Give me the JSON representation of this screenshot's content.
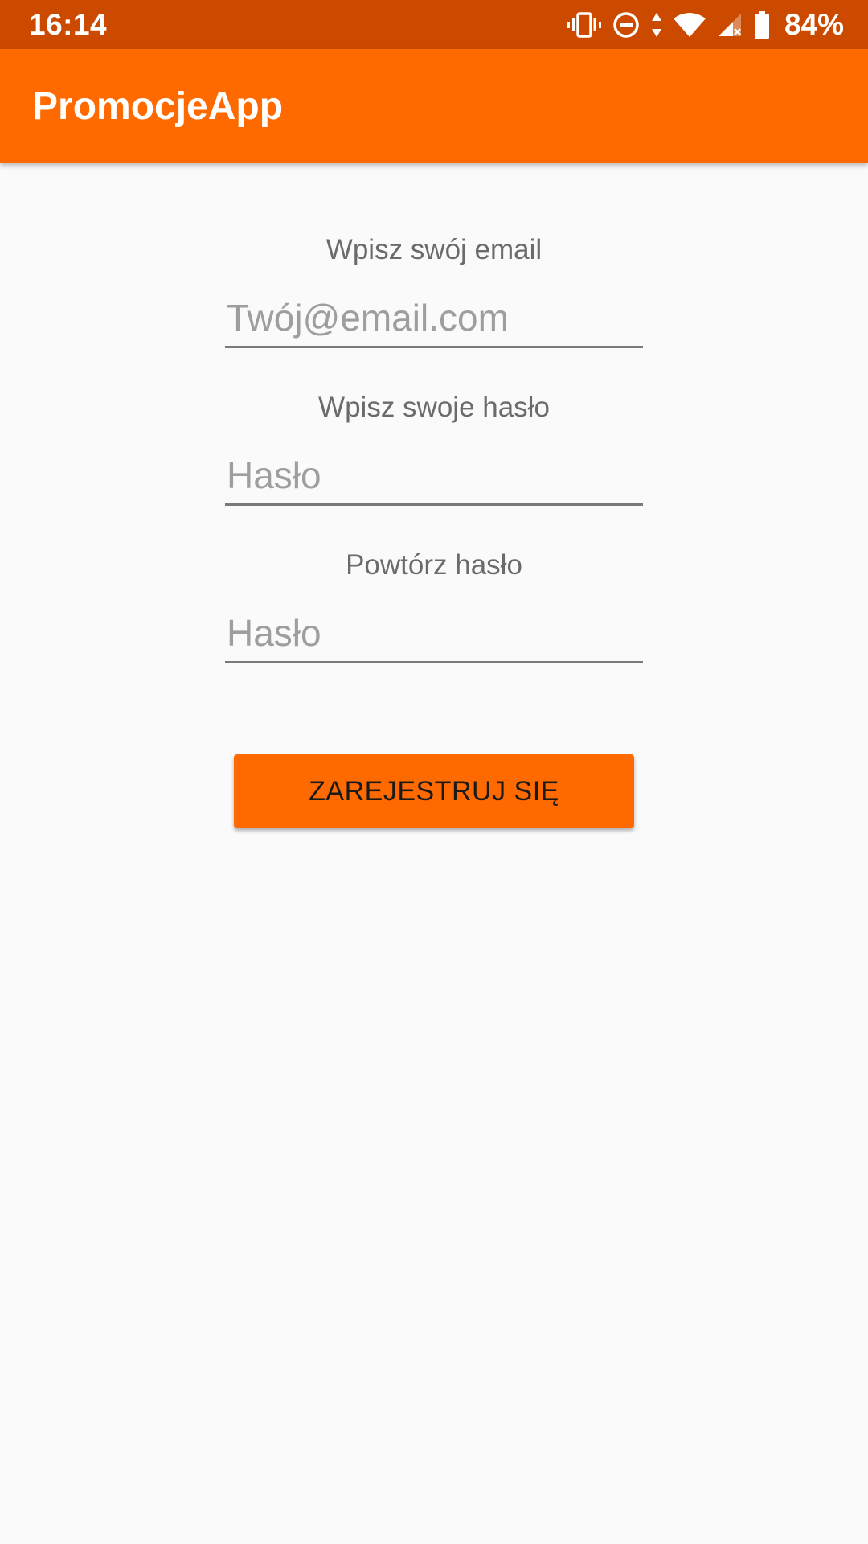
{
  "status_bar": {
    "time": "16:14",
    "battery": "84%",
    "icons": [
      "vibrate-icon",
      "do-not-disturb-icon",
      "data-arrows-icon",
      "wifi-icon",
      "cellular-no-signal-icon",
      "battery-icon"
    ]
  },
  "app_bar": {
    "title": "PromocjeApp"
  },
  "form": {
    "email_label": "Wpisz swój email",
    "email_placeholder": "Twój@email.com",
    "email_value": "",
    "password_label": "Wpisz swoje hasło",
    "password_placeholder": "Hasło",
    "password_value": "",
    "repeat_label": "Powtórz hasło",
    "repeat_placeholder": "Hasło",
    "repeat_value": "",
    "register_label": "ZAREJESTRUJ SIĘ"
  },
  "colors": {
    "status_bar": "#cc4a00",
    "primary": "#ff6a00",
    "background": "#fafafa"
  }
}
